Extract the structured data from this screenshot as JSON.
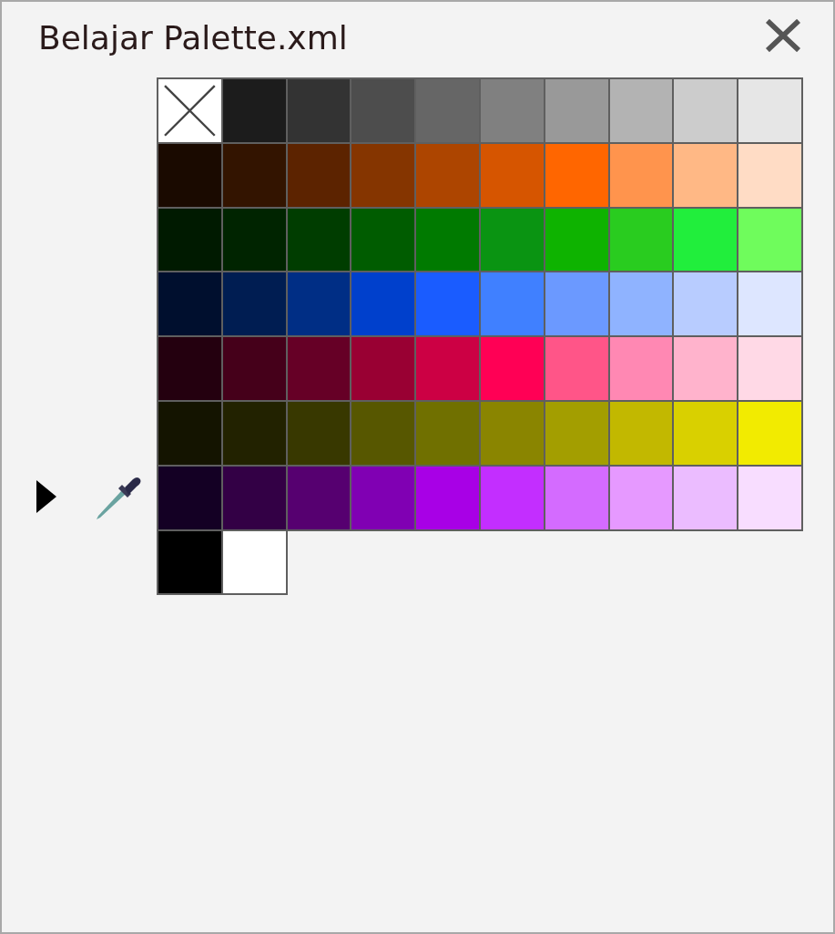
{
  "window": {
    "title": "Belajar Palette.xml"
  },
  "swatches": [
    {
      "kind": "none"
    },
    {
      "kind": "color",
      "color": "#1c1c1c"
    },
    {
      "kind": "color",
      "color": "#333333"
    },
    {
      "kind": "color",
      "color": "#4d4d4d"
    },
    {
      "kind": "color",
      "color": "#666666"
    },
    {
      "kind": "color",
      "color": "#808080"
    },
    {
      "kind": "color",
      "color": "#999999"
    },
    {
      "kind": "color",
      "color": "#b3b3b3"
    },
    {
      "kind": "color",
      "color": "#cccccc"
    },
    {
      "kind": "color",
      "color": "#e6e6e6"
    },
    {
      "kind": "color",
      "color": "#1a0a00"
    },
    {
      "kind": "color",
      "color": "#331400"
    },
    {
      "kind": "color",
      "color": "#5c2300"
    },
    {
      "kind": "color",
      "color": "#853500"
    },
    {
      "kind": "color",
      "color": "#ad4500"
    },
    {
      "kind": "color",
      "color": "#d65500"
    },
    {
      "kind": "color",
      "color": "#ff6600"
    },
    {
      "kind": "color",
      "color": "#ff944d"
    },
    {
      "kind": "color",
      "color": "#ffb885"
    },
    {
      "kind": "color",
      "color": "#ffdcc5"
    },
    {
      "kind": "color",
      "color": "#001a00"
    },
    {
      "kind": "color",
      "color": "#002400"
    },
    {
      "kind": "color",
      "color": "#003d00"
    },
    {
      "kind": "color",
      "color": "#005c00"
    },
    {
      "kind": "color",
      "color": "#007a00"
    },
    {
      "kind": "color",
      "color": "#0a9412"
    },
    {
      "kind": "color",
      "color": "#0eb300"
    },
    {
      "kind": "color",
      "color": "#29cc1f"
    },
    {
      "kind": "color",
      "color": "#21ee3c"
    },
    {
      "kind": "color",
      "color": "#6ffc5c"
    },
    {
      "kind": "color",
      "color": "#000f2e"
    },
    {
      "kind": "color",
      "color": "#001d52"
    },
    {
      "kind": "color",
      "color": "#002e85"
    },
    {
      "kind": "color",
      "color": "#0040cc"
    },
    {
      "kind": "color",
      "color": "#1a5cff"
    },
    {
      "kind": "color",
      "color": "#4080ff"
    },
    {
      "kind": "color",
      "color": "#6b99ff"
    },
    {
      "kind": "color",
      "color": "#8fb3ff"
    },
    {
      "kind": "color",
      "color": "#b8ccff"
    },
    {
      "kind": "color",
      "color": "#dde6ff"
    },
    {
      "kind": "color",
      "color": "#24000f"
    },
    {
      "kind": "color",
      "color": "#45001a"
    },
    {
      "kind": "color",
      "color": "#660026"
    },
    {
      "kind": "color",
      "color": "#990033"
    },
    {
      "kind": "color",
      "color": "#cc0044"
    },
    {
      "kind": "color",
      "color": "#ff0055"
    },
    {
      "kind": "color",
      "color": "#ff5588"
    },
    {
      "kind": "color",
      "color": "#ff88b3"
    },
    {
      "kind": "color",
      "color": "#ffb3cc"
    },
    {
      "kind": "color",
      "color": "#ffd9e6"
    },
    {
      "kind": "color",
      "color": "#141400"
    },
    {
      "kind": "color",
      "color": "#222200"
    },
    {
      "kind": "color",
      "color": "#383800"
    },
    {
      "kind": "color",
      "color": "#575700"
    },
    {
      "kind": "color",
      "color": "#707000"
    },
    {
      "kind": "color",
      "color": "#8a8500"
    },
    {
      "kind": "color",
      "color": "#a39e00"
    },
    {
      "kind": "color",
      "color": "#c2b800"
    },
    {
      "kind": "color",
      "color": "#d9d000"
    },
    {
      "kind": "color",
      "color": "#f2eb00"
    },
    {
      "kind": "color",
      "color": "#140024"
    },
    {
      "kind": "color",
      "color": "#330045"
    },
    {
      "kind": "color",
      "color": "#560070"
    },
    {
      "kind": "color",
      "color": "#8000b3"
    },
    {
      "kind": "color",
      "color": "#a800e6"
    },
    {
      "kind": "color",
      "color": "#c32eff"
    },
    {
      "kind": "color",
      "color": "#d46bff"
    },
    {
      "kind": "color",
      "color": "#e699ff"
    },
    {
      "kind": "color",
      "color": "#ebbcff"
    },
    {
      "kind": "color",
      "color": "#f8ddff"
    },
    {
      "kind": "color",
      "color": "#000000"
    },
    {
      "kind": "color",
      "color": "#ffffff"
    }
  ]
}
